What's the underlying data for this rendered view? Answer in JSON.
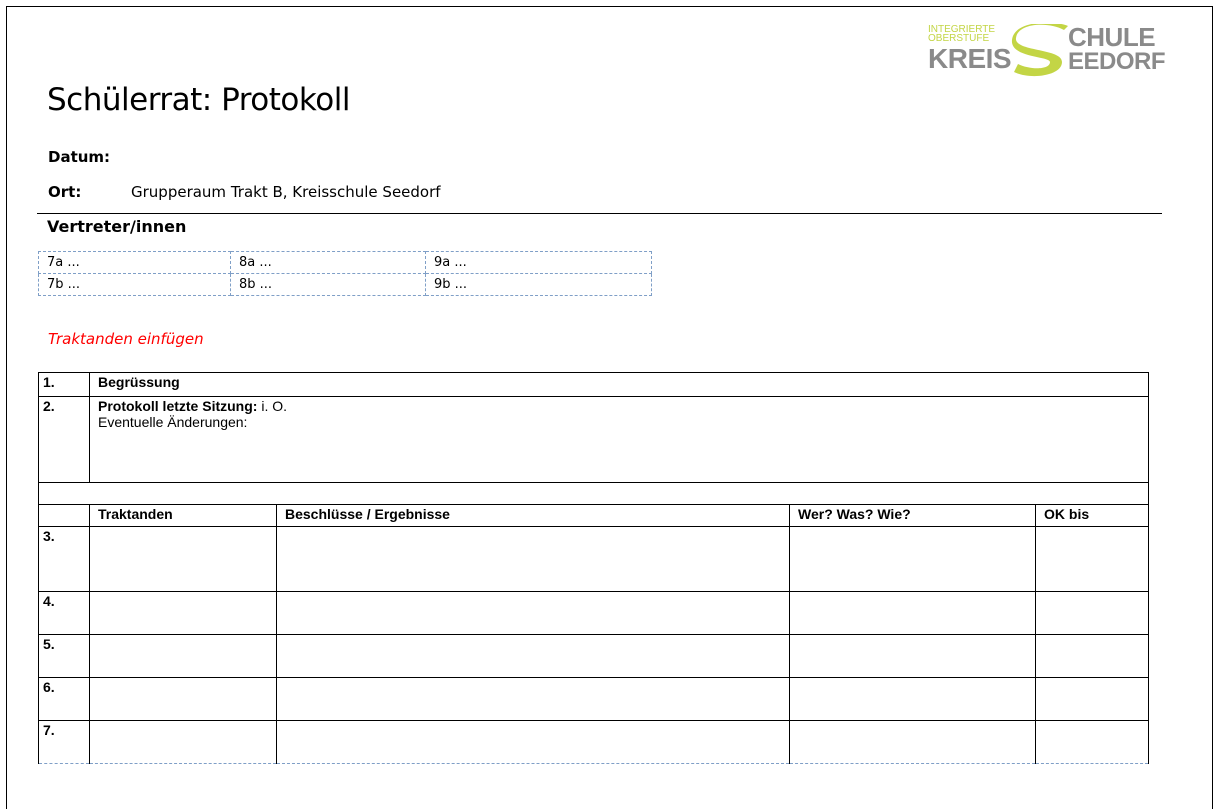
{
  "logo": {
    "line1": "INTEGRIERTE",
    "line2": "OBERSTUFE",
    "kreis": "KREIS",
    "chule": "CHULE",
    "eedorf": "EEDORF"
  },
  "title": "Schülerrat: Protokoll",
  "meta": {
    "datum_label": "Datum:",
    "ort_label": "Ort:",
    "ort_value": "Grupperaum Trakt B, Kreisschule Seedorf"
  },
  "representatives": {
    "heading": "Vertreter/innen",
    "rows": [
      [
        "7a ...",
        "8a ...",
        "9a ..."
      ],
      [
        "7b ...",
        "8b ...",
        "9b ..."
      ]
    ]
  },
  "hint": "Traktanden einfügen",
  "agenda": {
    "item1": {
      "num": "1.",
      "text": "Begrüssung"
    },
    "item2": {
      "num": "2.",
      "label": "Protokoll letzte Sitzung:",
      "value": " i. O.",
      "line2": "Eventuelle Änderungen:"
    },
    "headers": [
      "Traktanden",
      "Beschlüsse / Ergebnisse",
      "Wer? Was? Wie?",
      "OK bis"
    ],
    "rows": [
      "3.",
      "4.",
      "5.",
      "6.",
      "7."
    ]
  },
  "colors": {
    "logo_green": "#c3d545",
    "logo_gray": "#8a8a8a",
    "hint_red": "#ff0000",
    "dashed_border": "#7f9fc7"
  }
}
